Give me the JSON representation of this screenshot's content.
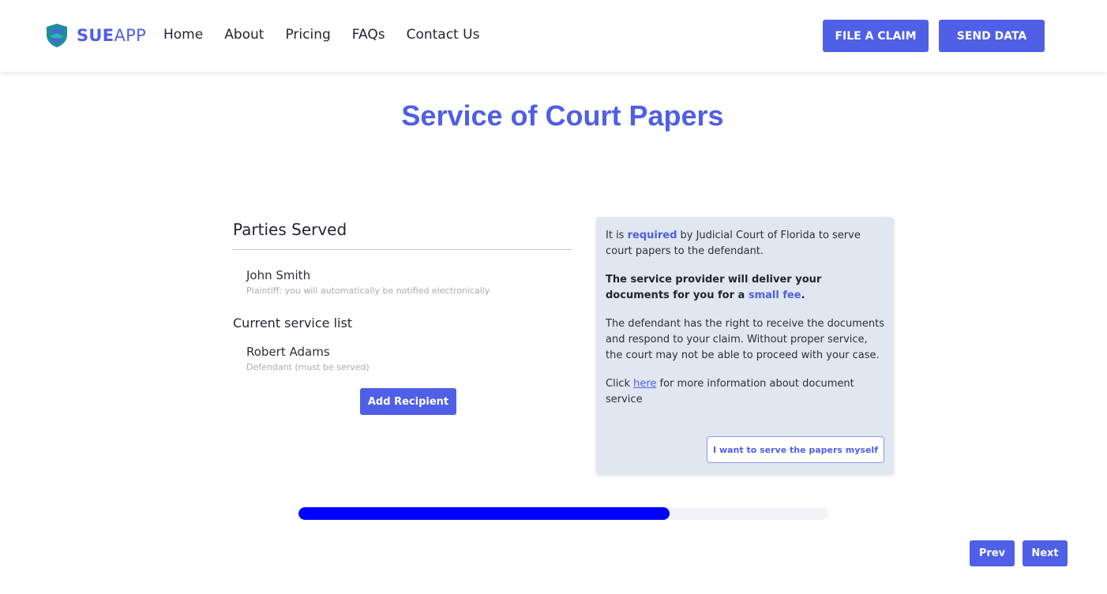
{
  "header": {
    "logo": {
      "bold": "SUE",
      "light": "APP",
      "icon": "shield-icon"
    },
    "nav": [
      "Home",
      "About",
      "Pricing",
      "FAQs",
      "Contact Us"
    ],
    "file_claim_label": "FILE A CLAIM",
    "send_data_label": "SEND DATA"
  },
  "page_title": "Service of Court Papers",
  "parties": {
    "title": "Parties Served",
    "plaintiff": {
      "name": "John Smith",
      "note": "Plaintiff: you will automatically be notified electronically"
    },
    "service_list_title": "Current service list",
    "defendant": {
      "name": "Robert Adams",
      "note": "Defendant (must be served)"
    },
    "add_recipient_label": "Add Recipient"
  },
  "info": {
    "p1_pre": "It is ",
    "p1_accent": "required",
    "p1_post": " by Judicial Court of Florida to serve court papers to the defendant.",
    "p2_pre": "The service provider will deliver your documents for you for a ",
    "p2_accent": "small fee",
    "p2_post": ".",
    "p3": "The defendant has the right to receive the documents and respond to your claim. Without proper service, the court may not be able to proceed with your case.",
    "p4_pre": "Click ",
    "p4_link": "here",
    "p4_post": " for more information about document service",
    "self_serve_label": "I want to serve the papers myself"
  },
  "progress": {
    "fraction": 0.7
  },
  "footer": {
    "prev_label": "Prev",
    "next_label": "Next"
  },
  "colors": {
    "accent": "#4f5fe6",
    "progress": "#0000ff",
    "panel": "#e0e7f1"
  }
}
